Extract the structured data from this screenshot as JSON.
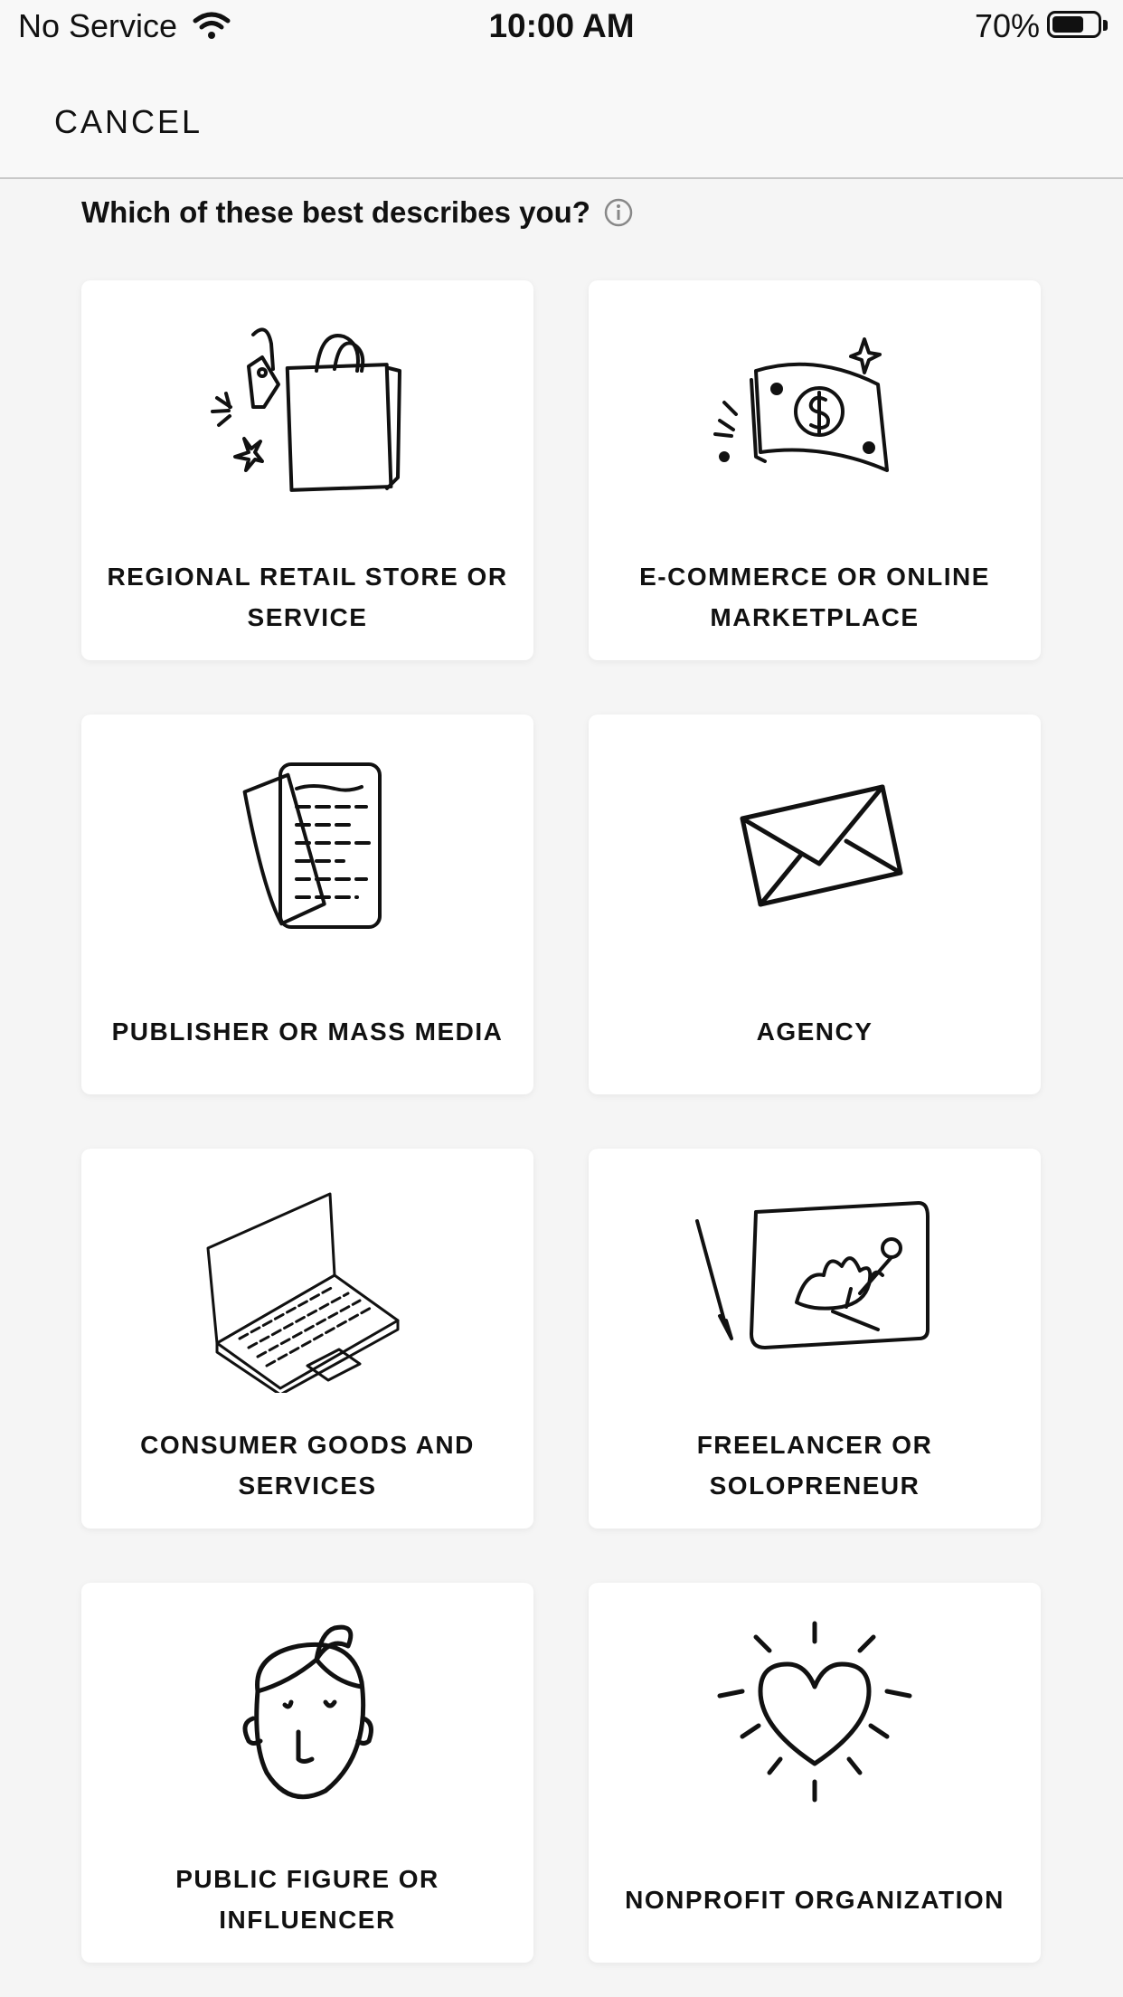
{
  "status_bar": {
    "carrier": "No Service",
    "time": "10:00 AM",
    "battery": "70%",
    "battery_level": 0.7
  },
  "nav": {
    "cancel_label": "CANCEL"
  },
  "question": {
    "text": "Which of these best describes you?",
    "info_icon": "info-icon"
  },
  "options": [
    {
      "label": "REGIONAL RETAIL STORE OR SERVICE",
      "icon": "shopping-bag-icon"
    },
    {
      "label": "E-COMMERCE OR ONLINE MARKETPLACE",
      "icon": "money-bill-icon"
    },
    {
      "label": "PUBLISHER OR MASS MEDIA",
      "icon": "documents-icon"
    },
    {
      "label": "AGENCY",
      "icon": "envelope-icon"
    },
    {
      "label": "CONSUMER GOODS AND SERVICES",
      "icon": "laptop-icon"
    },
    {
      "label": "FREELANCER OR SOLOPRENEUR",
      "icon": "canvas-painting-icon"
    },
    {
      "label": "PUBLIC FIGURE OR INFLUENCER",
      "icon": "face-icon"
    },
    {
      "label": "NONPROFIT ORGANIZATION",
      "icon": "heart-icon"
    }
  ]
}
